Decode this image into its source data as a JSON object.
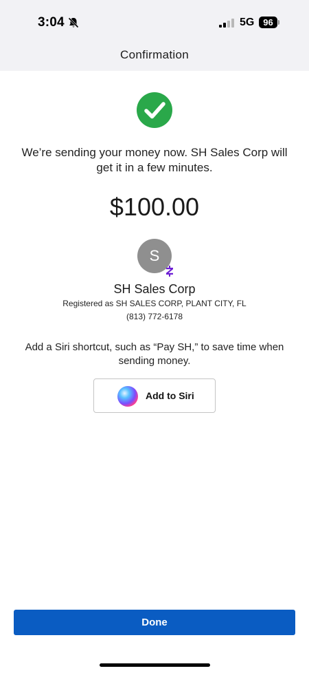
{
  "status_bar": {
    "time": "3:04",
    "network": "5G",
    "battery": "96",
    "icons": [
      "bell-muted-icon",
      "signal-icon",
      "battery-icon"
    ]
  },
  "header": {
    "title": "Confirmation"
  },
  "confirmation": {
    "icon": "success-check-icon",
    "message": "We’re sending your money now. SH Sales Corp will get it in a few minutes.",
    "amount": "$100.00"
  },
  "recipient": {
    "avatar_initial": "S",
    "name": "SH Sales Corp",
    "registered": "Registered as SH SALES CORP, PLANT CITY, FL",
    "phone": "(813) 772-6178",
    "badge_icon": "zelle-icon"
  },
  "siri": {
    "text": "Add a Siri shortcut, such as “Pay SH,” to save time when sending money.",
    "button_label": "Add to Siri",
    "icon": "siri-icon"
  },
  "footer": {
    "done_label": "Done"
  },
  "colors": {
    "accent": "#0a5cc2",
    "success": "#2aa84a",
    "zelle": "#6d1ed4",
    "header_bg": "#f2f2f5"
  }
}
